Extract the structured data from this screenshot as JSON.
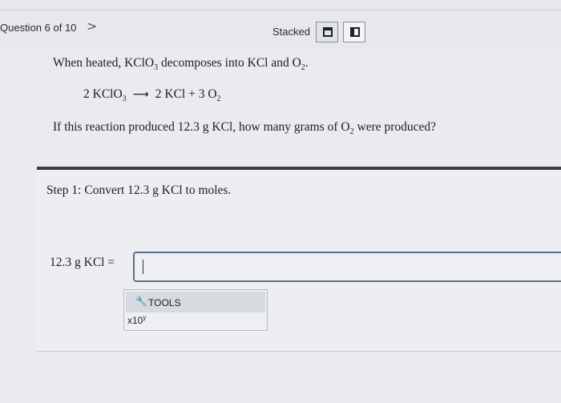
{
  "header": {
    "question_label": "Question 6 of 10",
    "next_symbol": ">",
    "view_mode_label": "Stacked",
    "view_buttons": [
      "stacked-view",
      "split-view"
    ]
  },
  "question": {
    "line1_a": "When heated, KClO",
    "line1_sub1": "3",
    "line1_b": " decomposes into KCl and O",
    "line1_sub2": "2",
    "line1_c": ".",
    "eq_a": "2 KClO",
    "eq_sub1": "3",
    "eq_arrow": "⟶",
    "eq_b": "2 KCl + 3 O",
    "eq_sub2": "2",
    "line3_a": "If this reaction produced 12.3 g KCl, how many grams of O",
    "line3_sub": "2",
    "line3_b": " were produced?"
  },
  "step": {
    "instruction": "Step 1: Convert 12.3 g KCl to moles.",
    "equation_label": "12.3 g KCl  =",
    "answer_value": ""
  },
  "tools": {
    "tools_icon": "wrench-icon",
    "tools_label": "TOOLS",
    "x10_base": "x10",
    "x10_exp": "y"
  },
  "colors": {
    "background": "#e9ebef",
    "divider": "#3c3e42",
    "input_border": "#5e6f8c"
  }
}
